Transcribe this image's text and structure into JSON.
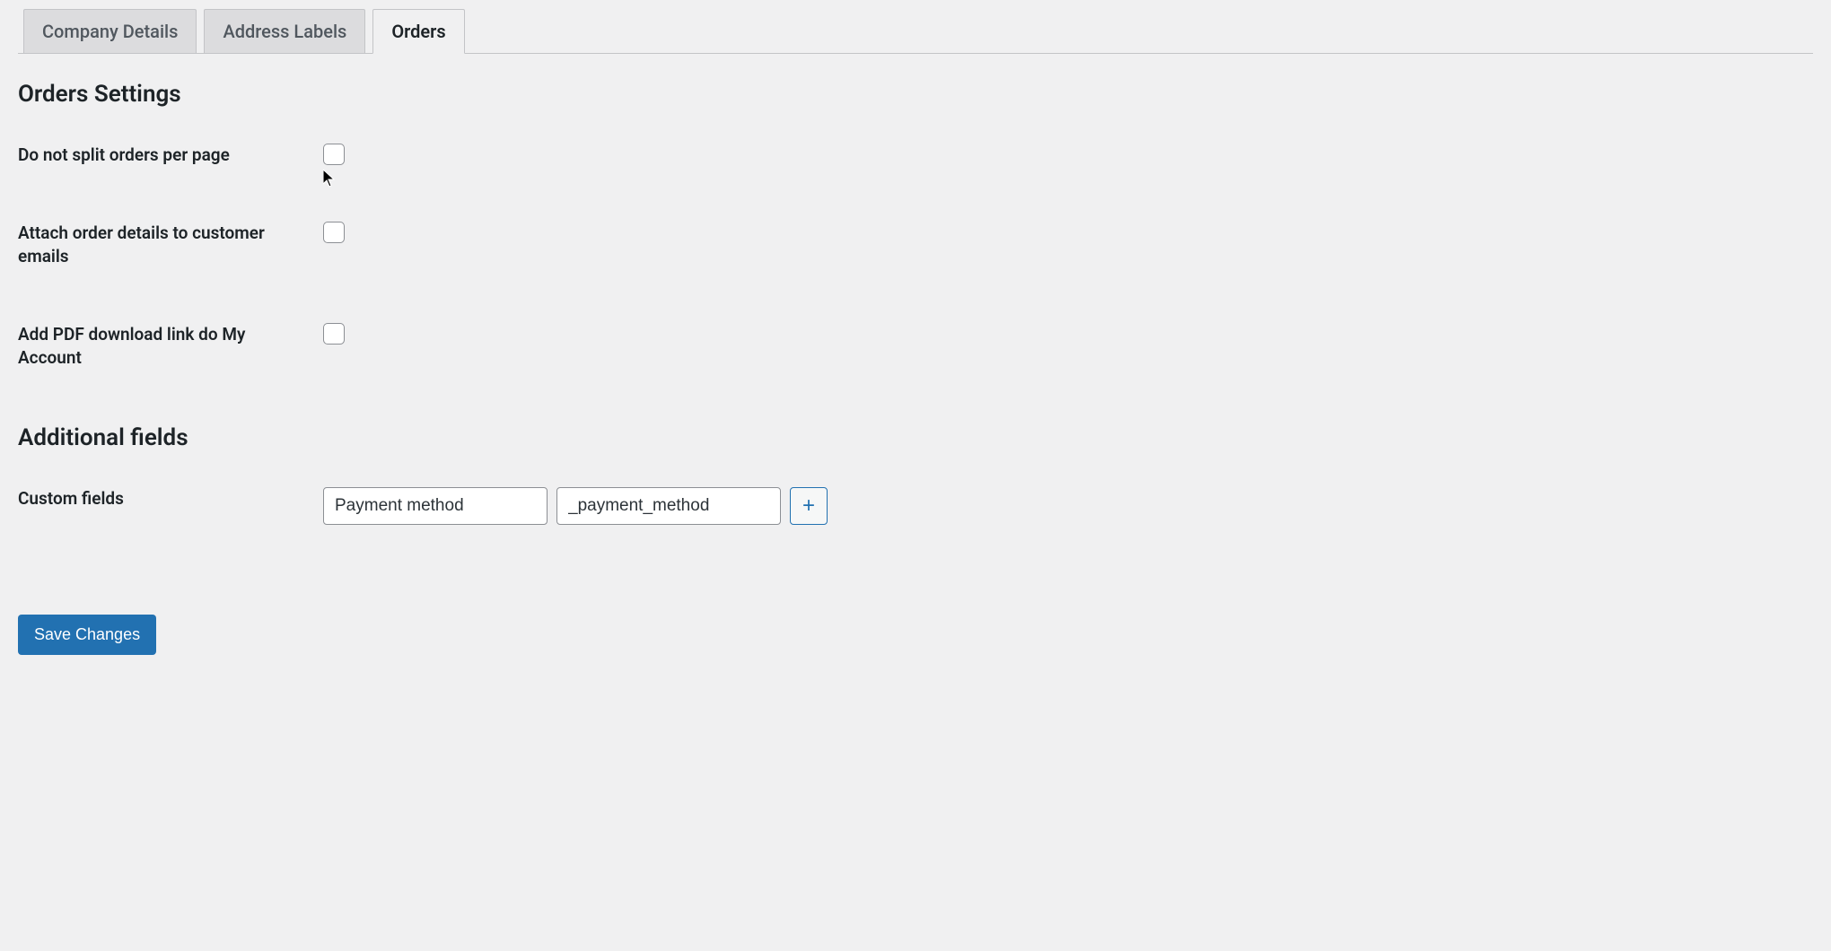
{
  "tabs": [
    {
      "label": "Company Details",
      "active": false
    },
    {
      "label": "Address Labels",
      "active": false
    },
    {
      "label": "Orders",
      "active": true
    }
  ],
  "section_title": "Orders Settings",
  "settings": {
    "do_not_split_label": "Do not split orders per page",
    "attach_order_details_label": "Attach order details to customer emails",
    "add_pdf_link_label": "Add PDF download link do My Account"
  },
  "additional_fields_title": "Additional fields",
  "custom_fields": {
    "label": "Custom fields",
    "name_value": "Payment method",
    "key_value": "_payment_method"
  },
  "save_button_label": "Save Changes",
  "add_button_label": "+"
}
